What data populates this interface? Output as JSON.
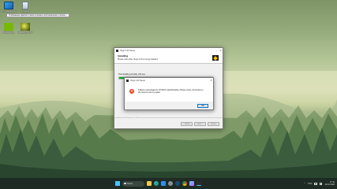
{
  "desktop": {
    "icons": [
      {
        "name": "this-pc",
        "label": "Этот компьютер",
        "icon": "monitor-icon"
      },
      {
        "name": "recycle-bin",
        "label": "Корзина",
        "icon": "recycle-bin-icon"
      },
      {
        "name": "nvidia-app",
        "label": "NVIDIA App",
        "icon": "nvidia-icon"
      },
      {
        "name": "nekoray",
        "label": "nekoray_v1.0.0",
        "icon": "nekoray-icon"
      }
    ],
    "tooltip": "Отображение файлов и папок в корзине, восстановление и полное..."
  },
  "installer": {
    "title": "Hugo 2.00 Setup",
    "heading": "Installing",
    "subheading": "Please wait while Hugo 2.00 is being installed.",
    "download_label": "Downloading vcredist_x64.exe",
    "progress": 0.14,
    "brand": "Nullsoft Install System v3.08",
    "buttons": {
      "back": "< Back",
      "next": "Next >",
      "cancel": "Cancel"
    }
  },
  "dialog": {
    "title": "Hugo 2.00 Setup",
    "message": "Failed to download the VC2015 redistributable. Please verify connection to the Internet and try again.",
    "ok_label": "OK"
  },
  "taskbar": {
    "search_placeholder": "Поиск",
    "pinned": [
      "file-explorer-icon",
      "edge-icon",
      "store-icon",
      "settings-icon",
      "steam-icon",
      "chrome-icon",
      "photos-icon",
      "installer-icon"
    ],
    "language": "РУС",
    "time": "17:11",
    "date": "19.12.2024"
  },
  "colors": {
    "progress_fill": "#06b025",
    "error_icon": "#e8431f",
    "taskbar_bg": "#1e2b24",
    "start_accent": "#4cc2ff"
  }
}
